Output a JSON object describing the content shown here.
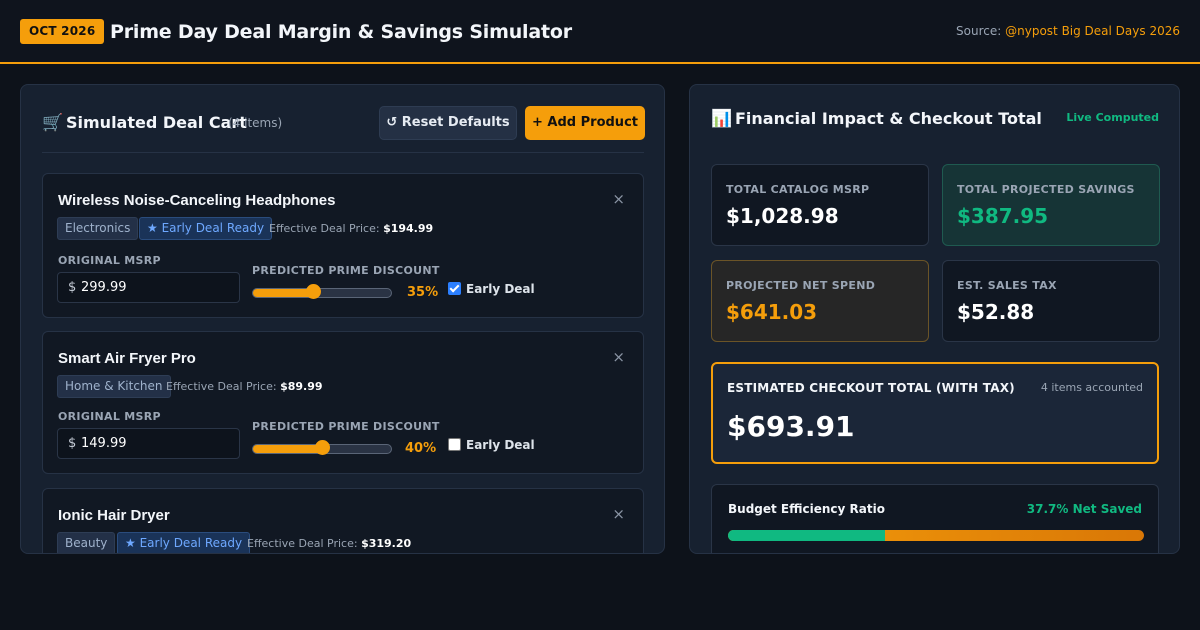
{
  "header": {
    "badge": "OCT 2026",
    "title": "Prime Day Deal Margin & Savings Simulator",
    "source_label": "Source: ",
    "source_link": "@nypost Big Deal Days 2026"
  },
  "cart": {
    "icon": "shopping-cart-icon",
    "title": "Simulated Deal Cart",
    "count_label": "(4 items)",
    "reset_label": "↺ Reset Defaults",
    "add_label": "+ Add Product",
    "field_msrp_label": "ORIGINAL MSRP",
    "field_discount_label": "PREDICTED PRIME DISCOUNT",
    "effective_label": "Effective Deal Price:",
    "early_deal_label": "Early Deal",
    "currency_symbol": "$",
    "close_symbol": "×",
    "items": [
      {
        "name": "Wireless Noise-Canceling Headphones",
        "category": "Electronics",
        "early_tag": "★ Early Deal Ready",
        "effective_price": "$194.99",
        "msrp": "299.99",
        "discount_label": "35%",
        "discount_fraction": 0.35,
        "early_checked": true
      },
      {
        "name": "Smart Air Fryer Pro",
        "category": "Home & Kitchen",
        "early_tag": "",
        "effective_price": "$89.99",
        "msrp": "149.99",
        "discount_label": "40%",
        "discount_fraction": 0.4,
        "early_checked": false
      },
      {
        "name": "Ionic Hair Dryer",
        "category": "Beauty",
        "early_tag": "★ Early Deal Ready",
        "effective_price": "$319.20"
      }
    ]
  },
  "impact": {
    "icon": "bar-chart-icon",
    "title": "Financial Impact & Checkout Total",
    "live_label": "Live Computed",
    "stats": [
      {
        "label": "TOTAL CATALOG MSRP",
        "value": "$1,028.98"
      },
      {
        "label": "TOTAL PROJECTED SAVINGS",
        "value": "$387.95"
      },
      {
        "label": "PROJECTED NET SPEND",
        "value": "$641.03"
      },
      {
        "label": "EST. SALES TAX",
        "value": "$52.88"
      }
    ],
    "checkout_label": "ESTIMATED CHECKOUT TOTAL (WITH TAX)",
    "checkout_count": "4 items accounted",
    "checkout_value": "$693.91",
    "budget_label": "Budget Efficiency Ratio",
    "budget_pct_label": "37.7% Net Saved",
    "budget_fraction": 0.377
  },
  "colors": {
    "accent": "#f59e0b",
    "success": "#10b981",
    "info": "#6ea8ff"
  }
}
